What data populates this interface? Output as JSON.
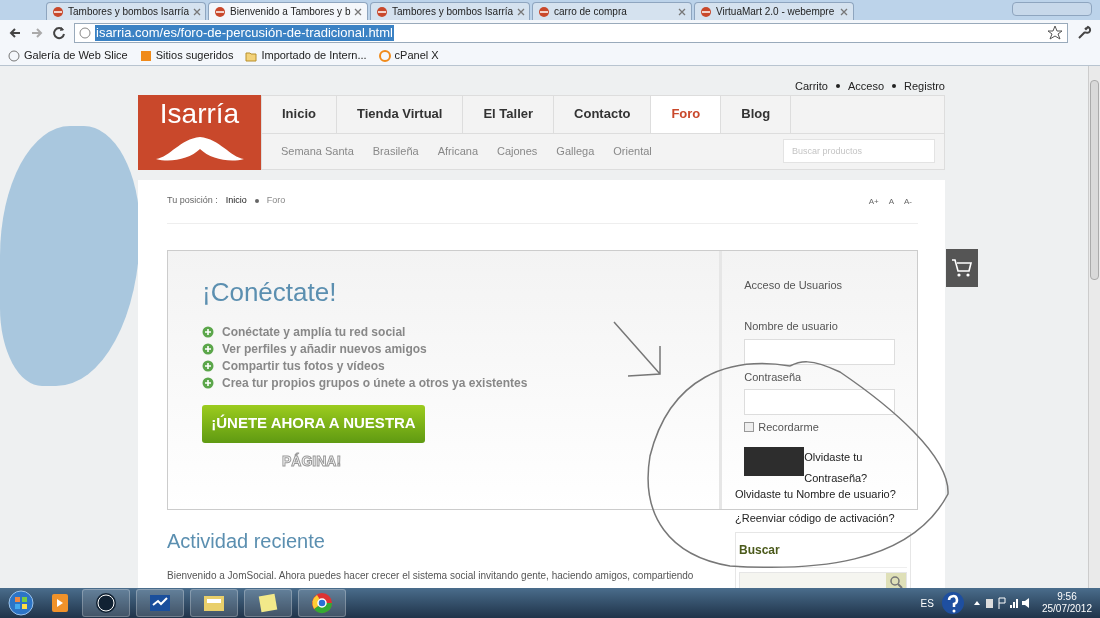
{
  "browser": {
    "tabs": [
      {
        "title": "Tambores y bombos Isarría",
        "selected": false
      },
      {
        "title": "Bienvenido a Tambores y b",
        "selected": true
      },
      {
        "title": "Tambores y bombos Isarría",
        "selected": false
      },
      {
        "title": "carro de compra",
        "selected": false
      },
      {
        "title": "VirtuaMart 2.0 - webempre",
        "selected": false
      }
    ],
    "url": "isarria.com/es/foro-de-percusión-de-tradicional.html",
    "bookmarks": [
      "Galería de Web Slice",
      "Sitios sugeridos",
      "Importado de Intern...",
      "cPanel X"
    ]
  },
  "site": {
    "top_links": [
      "Carrito",
      "Acceso",
      "Registro"
    ],
    "logo": "Isarría",
    "nav": [
      {
        "label": "Inicio",
        "selected": false
      },
      {
        "label": "Tienda Virtual",
        "selected": false
      },
      {
        "label": "El Taller",
        "selected": false
      },
      {
        "label": "Contacto",
        "selected": false
      },
      {
        "label": "Foro",
        "selected": true
      },
      {
        "label": "Blog",
        "selected": false
      }
    ],
    "subnav": [
      "Semana Santa",
      "Brasileña",
      "Africana",
      "Cajones",
      "Gallega",
      "Oriental"
    ],
    "product_search": {
      "placeholder": "Buscar productos"
    },
    "breadcrumb": {
      "label": "Tu posición :",
      "items": [
        "Inicio",
        "Foro"
      ]
    },
    "font_size_controls": [
      "A+",
      "A",
      "A-"
    ]
  },
  "connect": {
    "title": "¡Conéctate!",
    "features": [
      "Conéctate y amplía tu red social",
      "Ver perfiles y añadir nuevos amigos",
      "Compartir tus fotos y vídeos",
      "Crea tur propios grupos o únete a otros ya existentes"
    ],
    "join_button": "¡ÚNETE AHORA A NUESTRA",
    "join_button_overflow": "PÁGINA!"
  },
  "login": {
    "title": "Acceso de Usuarios",
    "username_label": "Nombre de usuario",
    "password_label": "Contraseña",
    "remember": {
      "label": "Recordarme",
      "checked": false
    },
    "forgot_password": "Olvidaste tu Contraseña?",
    "forgot_username": "Olvidaste tu Nombre de usuario?",
    "resend_activation": "¿Reenviar código de activación?"
  },
  "search_module": {
    "title": "Buscar"
  },
  "activity": {
    "title": "Actividad reciente",
    "text": "Bienvenido a JomSocial. Ahora puedes hacer crecer el sistema social invitando gente, haciendo amigos, compartiendo"
  },
  "taskbar": {
    "language": "ES",
    "time": "9:56",
    "date": "25/07/2012"
  }
}
